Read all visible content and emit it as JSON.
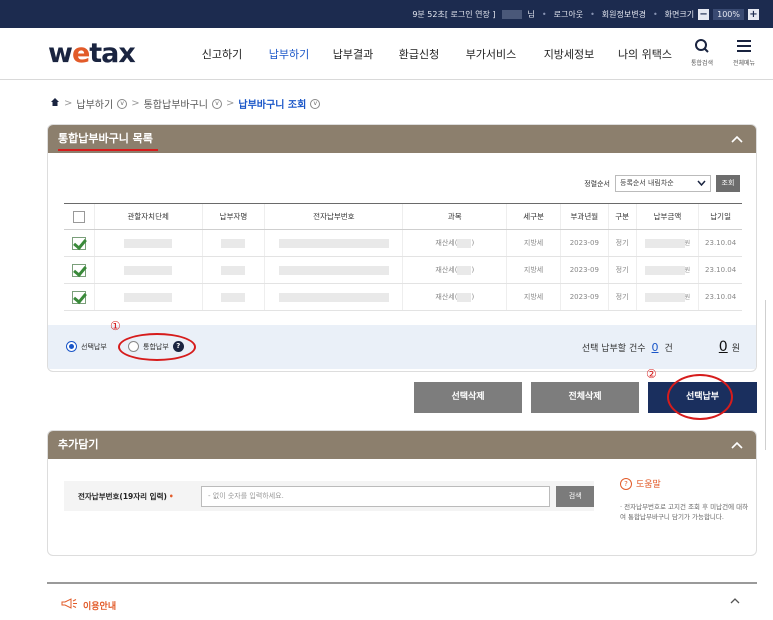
{
  "topbar": {
    "time_prefix": "9분 52초[ 로그인 연장 ]",
    "user_suffix": "님",
    "logout": "로그아웃",
    "member_edit": "회원정보변경",
    "zoom_label": "화면크기",
    "zoom_minus": "−",
    "zoom_value": "100%",
    "zoom_plus": "+"
  },
  "header": {
    "logo_w": "w",
    "logo_e": "e",
    "logo_rest": "tax",
    "nav": [
      "신고하기",
      "납부하기",
      "납부결과",
      "환급신청",
      "부가서비스",
      "지방세정보",
      "나의 위택스"
    ],
    "active_nav": "납부하기",
    "search_label": "통합검색",
    "menu_label": "전체메뉴"
  },
  "breadcrumb": [
    "납부하기",
    "통합납부바구니",
    "납부바구니 조회"
  ],
  "basket": {
    "title": "통합납부바구니 목록",
    "sort_label": "정렬순서",
    "sort_value": "등록순서 내림차순",
    "sort_button": "조회",
    "columns": [
      "관할자치단체",
      "납부자명",
      "전자납부번호",
      "과목",
      "세구분",
      "부과년월",
      "구분",
      "납부금액",
      "납기일"
    ],
    "rows": [
      {
        "subject": "재산세(",
        "subject_end": ")",
        "tax_type": "지방세",
        "month": "2023-09",
        "kind": "정기",
        "won": "원",
        "due": "23.10.04"
      },
      {
        "subject": "재산세(",
        "subject_end": ")",
        "tax_type": "지방세",
        "month": "2023-09",
        "kind": "정기",
        "won": "원",
        "due": "23.10.04"
      },
      {
        "subject": "재산세(",
        "subject_end": ")",
        "tax_type": "지방세",
        "month": "2023-09",
        "kind": "정기",
        "won": "원",
        "due": "23.10.04"
      }
    ],
    "radio_select": "선택납부",
    "radio_integrated": "통합납부",
    "help_mark": "?",
    "annot_1": "①",
    "summary_label": "선택 납부할 건수",
    "summary_count": "0",
    "summary_count_unit": "건",
    "summary_amount": "0",
    "summary_amount_unit": "원"
  },
  "actions": {
    "delete_selected": "선택삭제",
    "delete_all": "전체삭제",
    "pay_selected": "선택납부",
    "annot_2": "②"
  },
  "add": {
    "title": "추가담기",
    "field_label": "전자납부번호(19자리 입력)",
    "required_mark": "•",
    "placeholder": "- 없이 숫자를 입력하세요.",
    "search_button": "검색",
    "help_title": "도움말",
    "help_icon": "?",
    "help_text": "· 전자납부번호로 고지건 조회 후 미납건에 대하여 통합납부바구니 담기가 가능합니다."
  },
  "guide": {
    "title": "이용안내"
  },
  "colors": {
    "topbar": "#1c2b4f",
    "panel_header": "#8c7f6d",
    "accent_blue": "#1a56c8",
    "pay_button": "#1a2f5e",
    "annotation_red": "#d61c1c",
    "orange": "#e25b29"
  }
}
